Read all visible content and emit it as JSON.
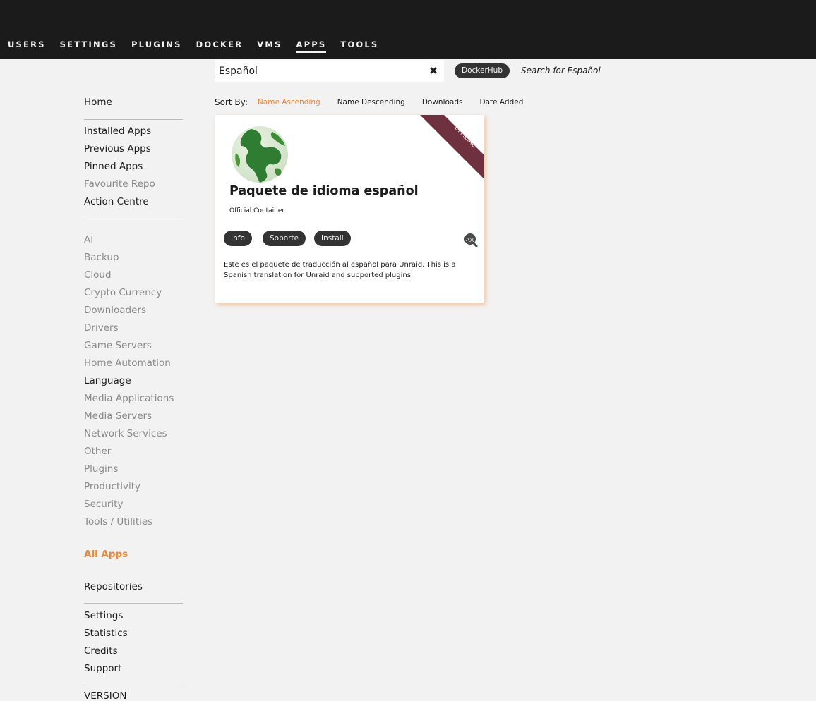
{
  "nav": [
    "USERS",
    "SETTINGS",
    "PLUGINS",
    "DOCKER",
    "VMS",
    "APPS",
    "TOOLS"
  ],
  "nav_active": "APPS",
  "search": {
    "value": "Español",
    "clear_icon": "✖",
    "dockerhub_label": "DockerHub",
    "search_for_text": "Search for Español"
  },
  "sort": {
    "label": "Sort By:",
    "options": [
      "Name Ascending",
      "Name Descending",
      "Downloads",
      "Date Added"
    ],
    "active": "Name Ascending"
  },
  "sidebar": {
    "home": "Home",
    "group1": [
      "Installed Apps",
      "Previous Apps",
      "Pinned Apps",
      "Favourite Repo",
      "Action Centre"
    ],
    "categories": [
      "AI",
      "Backup",
      "Cloud",
      "Crypto Currency",
      "Downloaders",
      "Drivers",
      "Game Servers",
      "Home Automation",
      "Language",
      "Media Applications",
      "Media Servers",
      "Network Services",
      "Other",
      "Plugins",
      "Productivity",
      "Security",
      "Tools / Utilities"
    ],
    "all_apps": "All Apps",
    "repositories": "Repositories",
    "group3": [
      "Settings",
      "Statistics",
      "Credits",
      "Support"
    ],
    "version": "VERSION"
  },
  "card": {
    "ribbon": "OFFICIAL",
    "title": "Paquete de idioma español",
    "subtitle": "Official Container",
    "buttons": [
      "Info",
      "Soporte",
      "Install"
    ],
    "language_icon": "translate-icon",
    "description": "Este es el paquete de traducción al español para Unraid. This is a Spanish translation for Unraid and supported plugins."
  },
  "colors": {
    "topbar": "#1c1b1b",
    "accent": "#f0883a",
    "ribbon": "#6f3140",
    "background": "#f2f2f2"
  }
}
